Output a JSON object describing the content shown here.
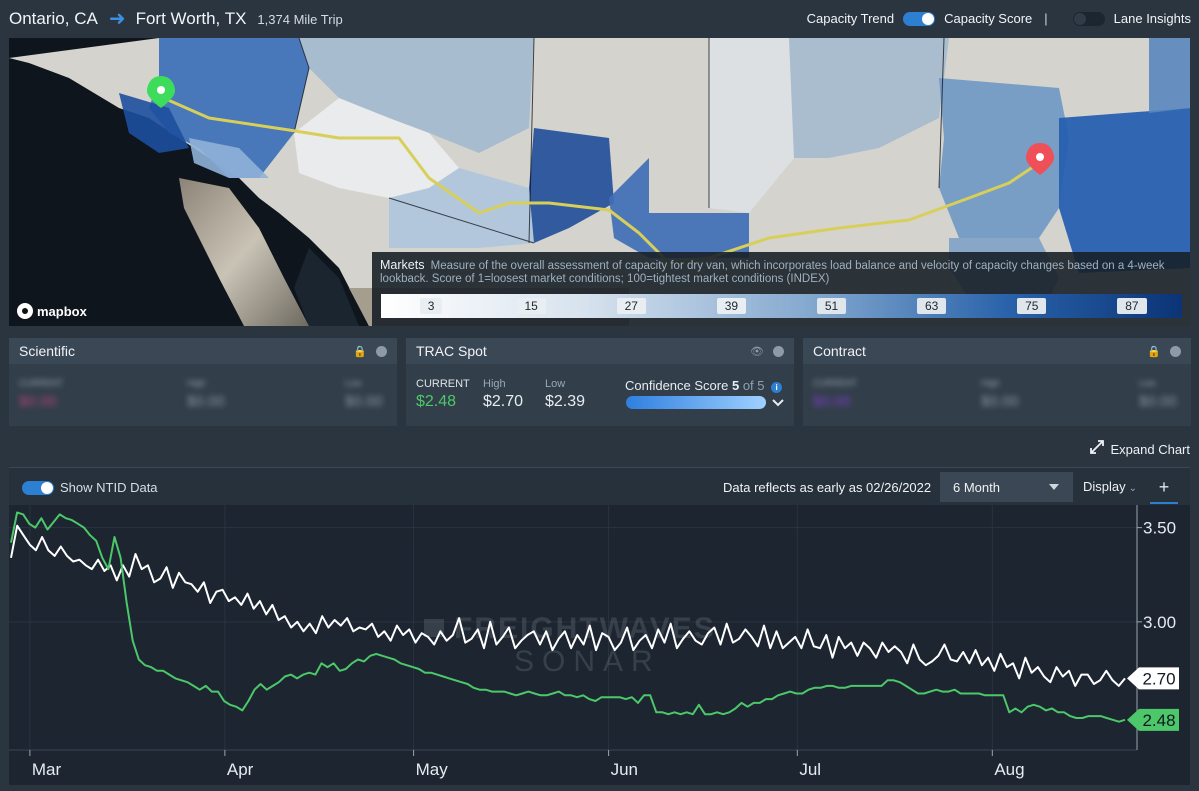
{
  "header": {
    "origin": "Ontario, CA",
    "destination": "Fort Worth, TX",
    "distance": "1,374 Mile Trip",
    "toggle_capacity_trend": "Capacity Trend",
    "toggle_capacity_score": "Capacity Score",
    "separator": "|",
    "toggle_lane_insights": "Lane Insights",
    "capacity_score_on": true,
    "lane_insights_on": false
  },
  "map": {
    "attribution": "mapbox",
    "legend_title": "Markets",
    "legend_description": "Measure of the overall assessment of capacity for dry van, which incorporates load balance and velocity of capacity changes based on a 4-week lookback. Score of 1=loosest market conditions; 100=tightest market conditions (INDEX)",
    "scale_values": [
      "3",
      "15",
      "27",
      "39",
      "51",
      "63",
      "75",
      "87"
    ],
    "origin_marker_color": "#3ddc5a",
    "destination_marker_color": "#ef4f57",
    "route_color": "#d8cf5a"
  },
  "cards": {
    "scientific": {
      "title": "Scientific",
      "current_label": "CURRENT",
      "current_value": "$0.00",
      "high_label": "High",
      "high_value": "$0.00",
      "low_label": "Low",
      "low_value": "$0.00"
    },
    "trac_spot": {
      "title": "TRAC Spot",
      "current_label": "CURRENT",
      "current_value": "$2.48",
      "high_label": "High",
      "high_value": "$2.70",
      "low_label": "Low",
      "low_value": "$2.39",
      "confidence_label": "Confidence Score",
      "confidence_score": "5",
      "confidence_of": "of 5",
      "confidence_fraction": 1.0
    },
    "contract": {
      "title": "Contract",
      "current_label": "CURRENT",
      "current_value": "$0.00",
      "high_label": "High",
      "high_value": "$0.00",
      "low_label": "Low",
      "low_value": "$0.00"
    }
  },
  "expand_chart": "Expand Chart",
  "chart_toolbar": {
    "ntid_label": "Show NTID Data",
    "ntid_on": true,
    "data_reflects": "Data reflects as early as 02/26/2022",
    "range_selected": "6 Month",
    "display_label": "Display"
  },
  "chart_data": {
    "type": "line",
    "watermark_top": "FREIGHTWAVES",
    "watermark_bottom": "SONAR",
    "x_tick_labels": [
      "Mar",
      "Apr",
      "May",
      "Jun",
      "Jul",
      "Aug"
    ],
    "y_tick_labels": [
      "3.50",
      "3.00"
    ],
    "ylim": [
      2.32,
      3.62
    ],
    "x_range": [
      "2022-02-26",
      "2022-08-24"
    ],
    "grid": true,
    "series": [
      {
        "color": "#ffffff",
        "last_value_label": "2.70",
        "values": [
          3.34,
          3.51,
          3.46,
          3.41,
          3.38,
          3.45,
          3.38,
          3.35,
          3.4,
          3.35,
          3.32,
          3.33,
          3.3,
          3.28,
          3.33,
          3.27,
          3.3,
          3.22,
          3.3,
          3.24,
          3.36,
          3.28,
          3.3,
          3.21,
          3.23,
          3.29,
          3.18,
          3.26,
          3.21,
          3.2,
          3.16,
          3.21,
          3.1,
          3.16,
          3.17,
          3.11,
          3.13,
          3.09,
          3.15,
          3.07,
          3.11,
          3.04,
          3.09,
          3.01,
          3.03,
          2.97,
          3.0,
          2.95,
          2.99,
          2.94,
          3.03,
          2.97,
          3.01,
          2.98,
          3.02,
          2.95,
          2.97,
          2.96,
          2.99,
          2.92,
          2.95,
          2.9,
          2.98,
          2.93,
          2.96,
          2.89,
          2.94,
          2.92,
          2.88,
          2.95,
          2.9,
          2.93,
          3.02,
          2.89,
          2.91,
          2.96,
          2.86,
          3.0,
          2.88,
          2.92,
          2.97,
          2.86,
          2.9,
          2.93,
          2.95,
          2.88,
          2.95,
          2.85,
          2.91,
          2.95,
          2.86,
          2.93,
          2.88,
          2.98,
          2.85,
          2.94,
          2.92,
          2.85,
          2.89,
          2.97,
          2.85,
          2.9,
          2.93,
          2.86,
          2.96,
          2.89,
          2.99,
          2.86,
          2.91,
          2.95,
          2.9,
          2.88,
          2.94,
          2.97,
          2.88,
          2.99,
          2.89,
          2.91,
          2.96,
          2.92,
          2.87,
          2.98,
          2.86,
          2.95,
          2.86,
          2.89,
          2.92,
          2.86,
          2.96,
          2.87,
          2.86,
          2.93,
          2.81,
          2.92,
          2.86,
          2.89,
          2.82,
          2.89,
          2.86,
          2.81,
          2.89,
          2.84,
          2.87,
          2.84,
          2.78,
          2.88,
          2.8,
          2.77,
          2.79,
          2.82,
          2.88,
          2.8,
          2.79,
          2.84,
          2.78,
          2.85,
          2.77,
          2.81,
          2.74,
          2.83,
          2.76,
          2.78,
          2.7,
          2.81,
          2.73,
          2.76,
          2.71,
          2.68,
          2.76,
          2.71,
          2.74,
          2.66,
          2.72,
          2.72,
          2.67,
          2.69,
          2.74,
          2.69,
          2.66,
          2.7
        ]
      },
      {
        "color": "#4cc86a",
        "last_value_label": "2.48",
        "values": [
          3.42,
          3.58,
          3.57,
          3.52,
          3.5,
          3.55,
          3.49,
          3.53,
          3.57,
          3.55,
          3.54,
          3.52,
          3.5,
          3.46,
          3.43,
          3.34,
          3.28,
          3.45,
          3.34,
          3.1,
          2.9,
          2.8,
          2.77,
          2.76,
          2.74,
          2.74,
          2.72,
          2.7,
          2.69,
          2.68,
          2.66,
          2.64,
          2.66,
          2.63,
          2.63,
          2.58,
          2.56,
          2.55,
          2.53,
          2.58,
          2.64,
          2.67,
          2.64,
          2.66,
          2.68,
          2.71,
          2.72,
          2.7,
          2.72,
          2.73,
          2.72,
          2.78,
          2.76,
          2.78,
          2.74,
          2.75,
          2.78,
          2.8,
          2.79,
          2.82,
          2.83,
          2.82,
          2.81,
          2.8,
          2.78,
          2.77,
          2.76,
          2.75,
          2.73,
          2.73,
          2.72,
          2.71,
          2.7,
          2.69,
          2.68,
          2.67,
          2.65,
          2.64,
          2.64,
          2.63,
          2.63,
          2.63,
          2.62,
          2.61,
          2.62,
          2.63,
          2.62,
          2.61,
          2.61,
          2.62,
          2.63,
          2.61,
          2.61,
          2.6,
          2.61,
          2.59,
          2.58,
          2.6,
          2.6,
          2.6,
          2.6,
          2.59,
          2.6,
          2.57,
          2.61,
          2.61,
          2.52,
          2.52,
          2.51,
          2.52,
          2.51,
          2.52,
          2.51,
          2.56,
          2.51,
          2.51,
          2.52,
          2.51,
          2.52,
          2.54,
          2.57,
          2.55,
          2.57,
          2.57,
          2.59,
          2.59,
          2.61,
          2.62,
          2.63,
          2.62,
          2.62,
          2.64,
          2.65,
          2.65,
          2.66,
          2.66,
          2.65,
          2.65,
          2.66,
          2.66,
          2.66,
          2.66,
          2.66,
          2.66,
          2.69,
          2.69,
          2.68,
          2.66,
          2.64,
          2.62,
          2.62,
          2.63,
          2.64,
          2.63,
          2.63,
          2.64,
          2.62,
          2.62,
          2.62,
          2.62,
          2.61,
          2.61,
          2.61,
          2.61,
          2.52,
          2.54,
          2.52,
          2.55,
          2.56,
          2.55,
          2.53,
          2.54,
          2.52,
          2.52,
          2.5,
          2.49,
          2.49,
          2.5,
          2.5,
          2.5,
          2.49,
          2.48,
          2.47,
          2.48
        ]
      }
    ]
  }
}
